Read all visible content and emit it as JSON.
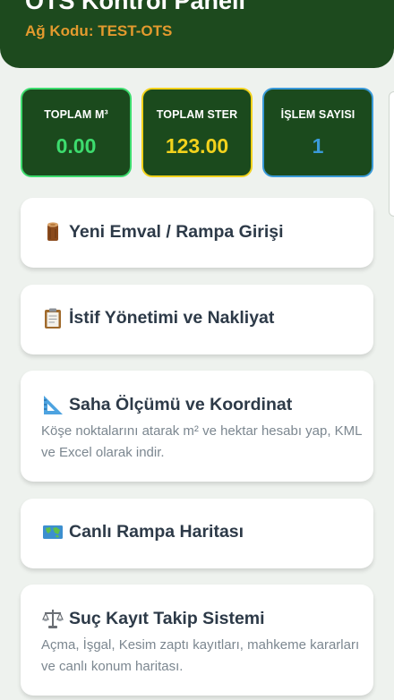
{
  "header": {
    "title": "OTS Kontrol Paneli",
    "network_code": "Ağ Kodu: TEST-OTS",
    "colors": {
      "background": "#1d4a1e",
      "accent": "#e39a2e"
    }
  },
  "stats": [
    {
      "label": "TOPLAM M³",
      "value": "0.00",
      "color": "#3ddc6e"
    },
    {
      "label": "TOPLAM STER",
      "value": "123.00",
      "color": "#f2d21c"
    },
    {
      "label": "İŞLEM SAYISI",
      "value": "1",
      "color": "#3a9ad8"
    }
  ],
  "menu": [
    {
      "icon": "log-icon",
      "title": "Yeni Emval / Rampa Girişi",
      "description": ""
    },
    {
      "icon": "clipboard-icon",
      "title": "İstif Yönetimi ve Nakliyat",
      "description": ""
    },
    {
      "icon": "triangle-ruler-icon",
      "title": "Saha Ölçümü ve Koordinat",
      "description": "Köşe noktalarını atarak m² ve hektar hesabı yap, KML ve Excel olarak indir."
    },
    {
      "icon": "world-map-icon",
      "title": "Canlı Rampa Haritası",
      "description": ""
    },
    {
      "icon": "scales-icon",
      "title": "Suç Kayıt Takip Sistemi",
      "description": "Açma, İşgal, Kesim zaptı kayıtları, mahkeme kararları ve canlı konum haritası."
    }
  ]
}
